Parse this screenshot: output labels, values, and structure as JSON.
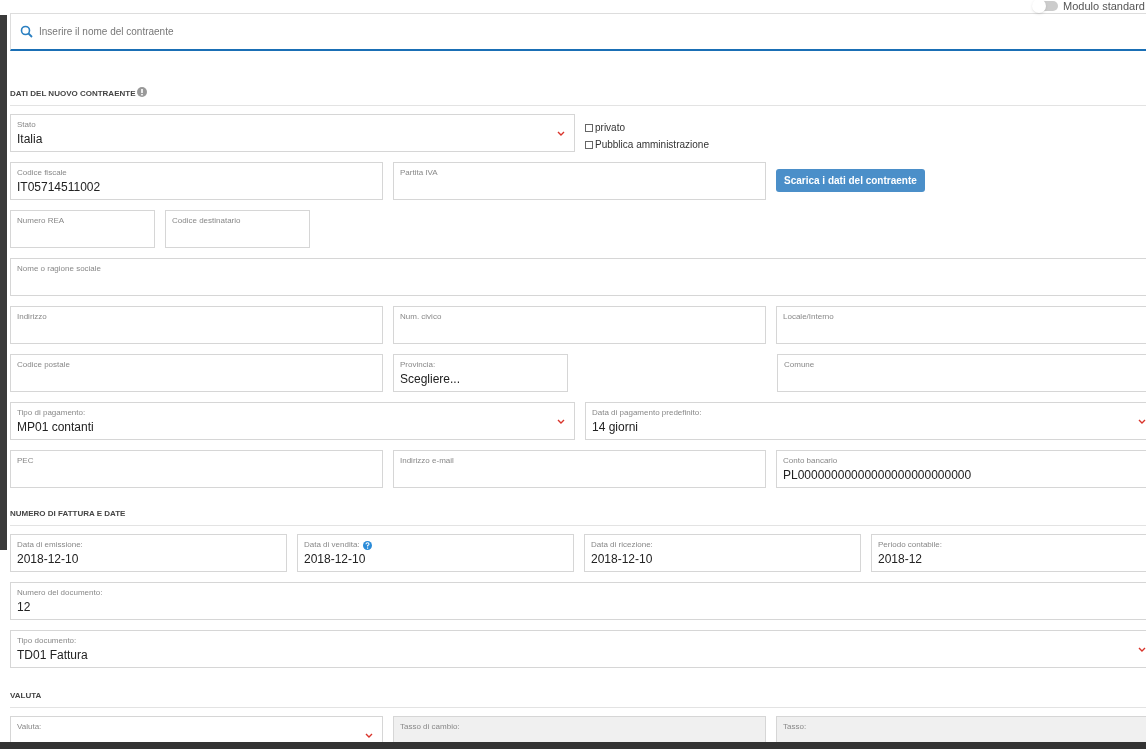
{
  "toggle": {
    "label": "Modulo standard",
    "on": false
  },
  "search": {
    "placeholder": "Inserire il nome del contraente"
  },
  "sections": [
    {
      "title": "DATI DEL NUOVO CONTRAENTE",
      "info_icon": true,
      "rows": [
        [
          {
            "kind": "select",
            "label": "Stato",
            "value": "Italia"
          },
          {
            "kind": "checkboxes",
            "options": [
              {
                "label": "privato",
                "checked": false
              },
              {
                "label": "Pubblica amministrazione",
                "checked": false
              }
            ]
          }
        ],
        [
          {
            "kind": "text",
            "label": "Codice fiscale",
            "value": "IT05714511002"
          },
          {
            "kind": "text",
            "label": "Partita IVA"
          },
          {
            "kind": "button",
            "label": "Scarica i dati del contraente"
          }
        ],
        [
          {
            "kind": "text",
            "label": "Numero REA"
          },
          {
            "kind": "text",
            "label": "Codice destinatario"
          }
        ],
        [
          {
            "kind": "text",
            "label": "Nome o ragione sociale"
          }
        ],
        [
          {
            "kind": "text",
            "label": "Indirizzo"
          },
          {
            "kind": "text",
            "label": "Num. civico"
          },
          {
            "kind": "text",
            "label": "Locale/Interno"
          }
        ],
        [
          {
            "kind": "text",
            "label": "Codice postale"
          },
          {
            "kind": "text",
            "label": "Provincia:",
            "value": "Scegliere..."
          },
          {
            "kind": "text",
            "label": "Comune"
          }
        ],
        [
          {
            "kind": "select",
            "label": "Tipo di pagamento:",
            "value": "MP01 contanti"
          },
          {
            "kind": "select",
            "label": "Data di pagamento predefinito:",
            "value": "14 giorni"
          }
        ],
        [
          {
            "kind": "text",
            "label": "PEC"
          },
          {
            "kind": "text",
            "label": "Indirizzo e-mail"
          },
          {
            "kind": "text",
            "label": "Conto bancario",
            "value": "PL00000000000000000000000000"
          }
        ]
      ]
    },
    {
      "title": "NUMERO DI FATTURA E DATE",
      "info_icon": false,
      "rows": [
        [
          {
            "kind": "text",
            "label": "Data di emissione:",
            "value": "2018-12-10"
          },
          {
            "kind": "text",
            "label": "Data di vendita:",
            "value": "2018-12-10",
            "help_icon": true
          },
          {
            "kind": "text",
            "label": "Data di ricezione:",
            "value": "2018-12-10"
          },
          {
            "kind": "text",
            "label": "Periodo contabile:",
            "value": "2018-12"
          }
        ],
        [
          {
            "kind": "text",
            "label": "Numero del documento:",
            "value": "12"
          }
        ],
        [
          {
            "kind": "select",
            "label": "Tipo documento:",
            "value": "TD01 Fattura"
          }
        ]
      ]
    },
    {
      "title": "VALUTA",
      "info_icon": false,
      "rows": [
        [
          {
            "kind": "select",
            "label": "Valuta:"
          },
          {
            "kind": "readonly",
            "label": "Tasso di cambio:"
          },
          {
            "kind": "readonly",
            "label": "Tasso:"
          }
        ]
      ]
    }
  ]
}
